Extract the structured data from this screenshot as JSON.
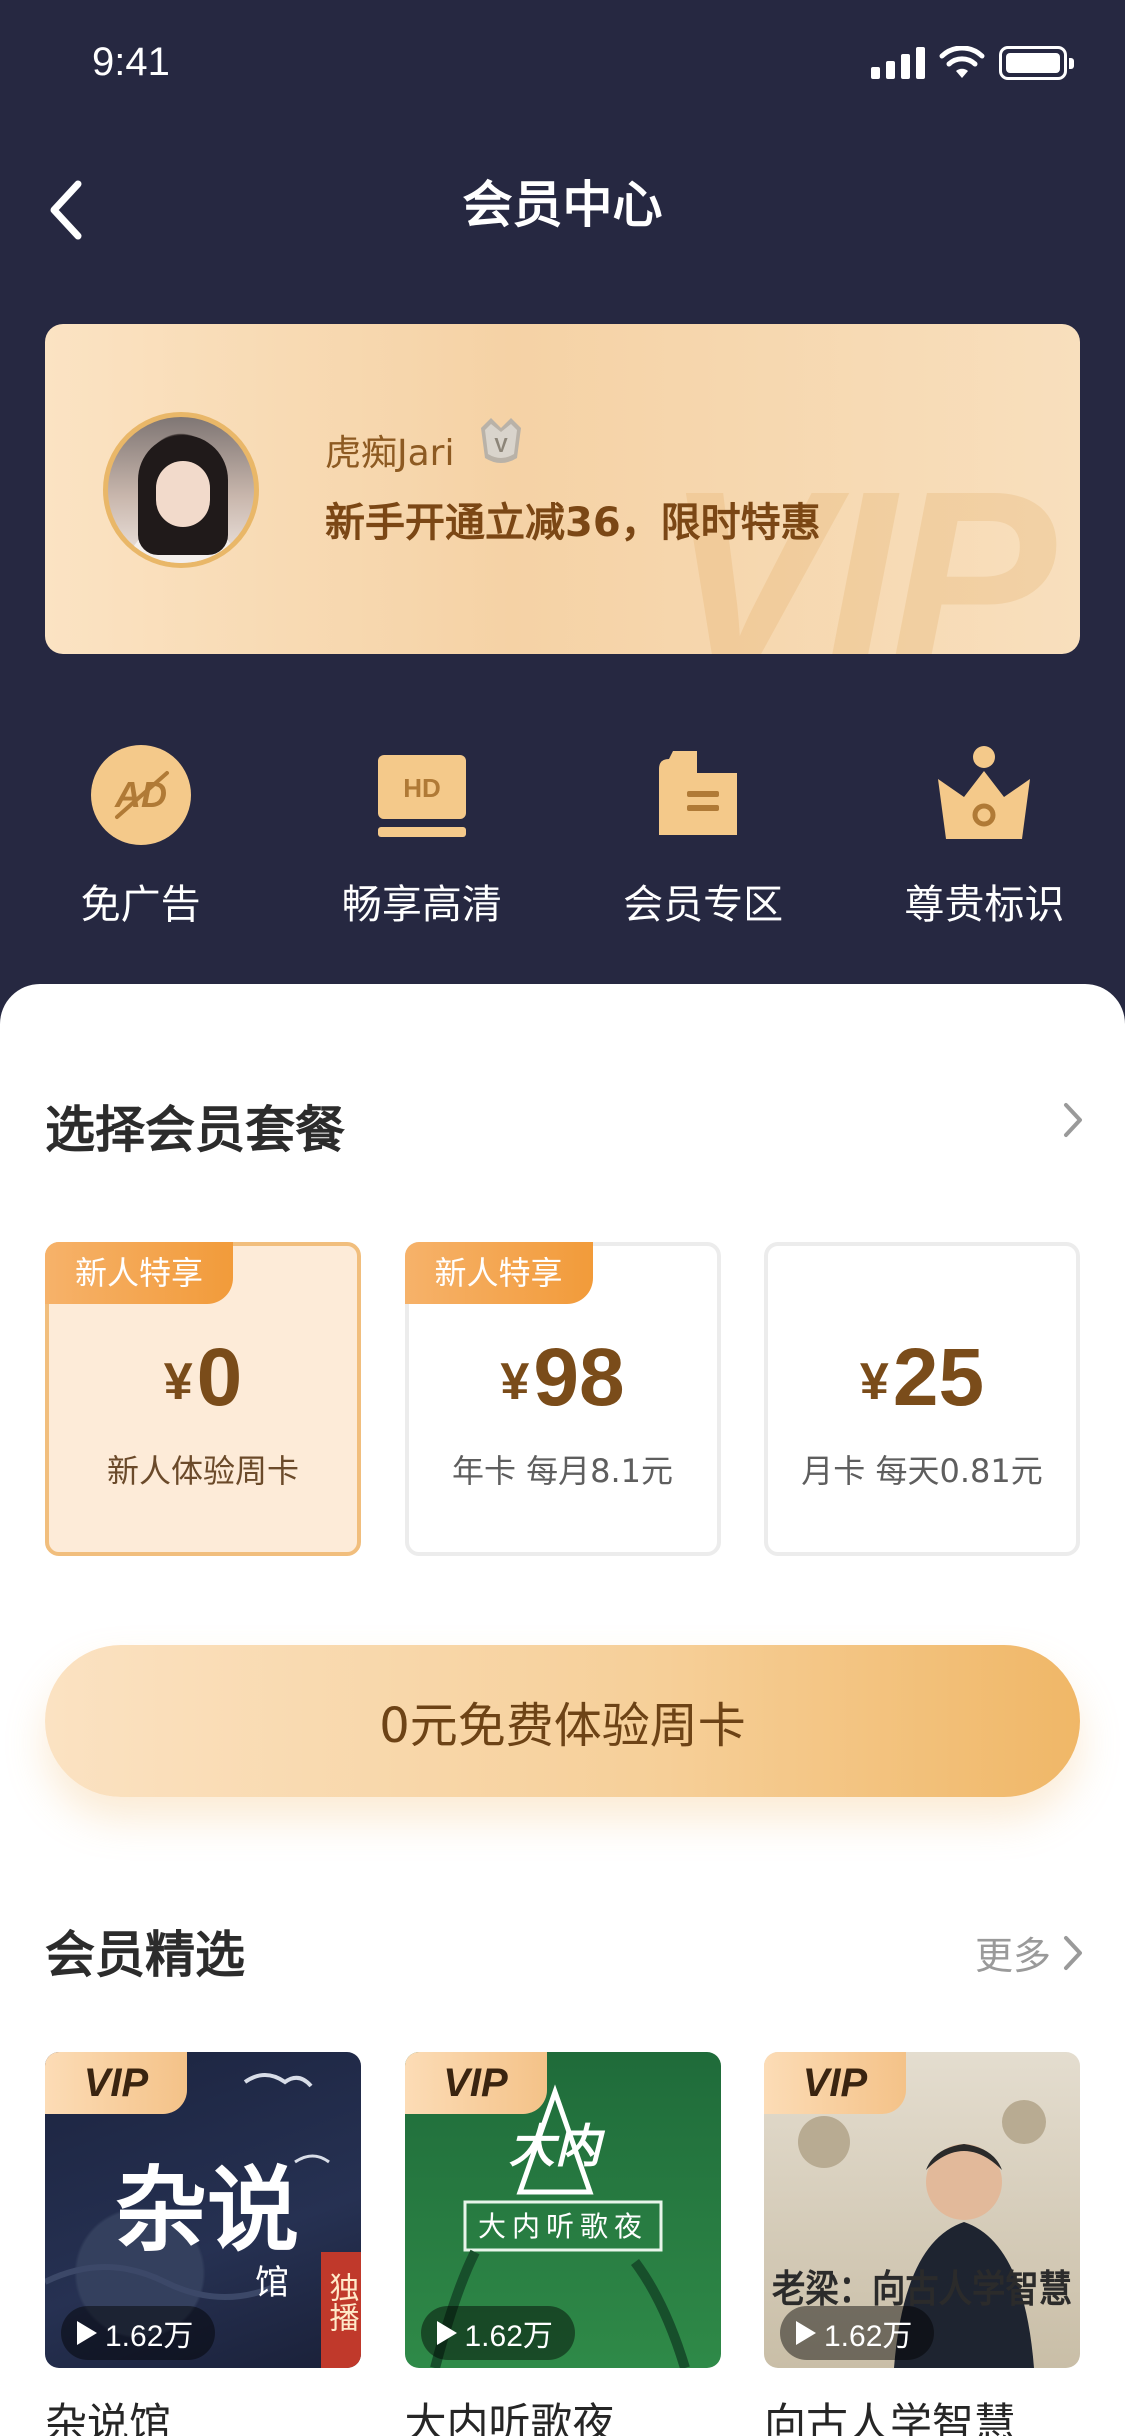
{
  "status_bar": {
    "time": "9:41"
  },
  "nav": {
    "title": "会员中心"
  },
  "vip_card": {
    "user_name": "虎痴Jari",
    "promo": "新手开通立减36，限时特惠",
    "watermark": "VIP",
    "badge_letter": "V"
  },
  "benefits": [
    {
      "icon": "no-ad-icon",
      "label": "免广告",
      "icon_text": "AD"
    },
    {
      "icon": "hd-icon",
      "label": "畅享高清",
      "icon_text": "HD"
    },
    {
      "icon": "member-zone-icon",
      "label": "会员专区"
    },
    {
      "icon": "crown-icon",
      "label": "尊贵标识"
    }
  ],
  "plans_section": {
    "title": "选择会员套餐",
    "plans": [
      {
        "tag": "新人特享",
        "currency": "¥",
        "price": "0",
        "desc": "新人体验周卡",
        "selected": true
      },
      {
        "tag": "新人特享",
        "currency": "¥",
        "price": "98",
        "desc": "年卡 每月8.1元",
        "selected": false
      },
      {
        "tag": "",
        "currency": "¥",
        "price": "25",
        "desc": "月卡 每天0.81元",
        "selected": false
      }
    ]
  },
  "cta": {
    "label": "0元免费体验周卡"
  },
  "picks_section": {
    "title": "会员精选",
    "more": "更多",
    "items": [
      {
        "badge": "VIP",
        "plays": "1.62万",
        "title": "杂说馆",
        "cover_text": "杂说",
        "cover_sub": "馆",
        "cover_tag": "独播"
      },
      {
        "badge": "VIP",
        "plays": "1.62万",
        "title": "大内听歌夜",
        "cover_text": "大内",
        "cover_sub": "大内听歌夜"
      },
      {
        "badge": "VIP",
        "plays": "1.62万",
        "title": "向古人学智慧",
        "cover_text": "老梁：向古人学智慧"
      }
    ]
  },
  "colors": {
    "header_bg": "#262841",
    "gold": "#f0b767",
    "tag_orange": "#f29b3a",
    "price_brown": "#7a4c1a"
  }
}
